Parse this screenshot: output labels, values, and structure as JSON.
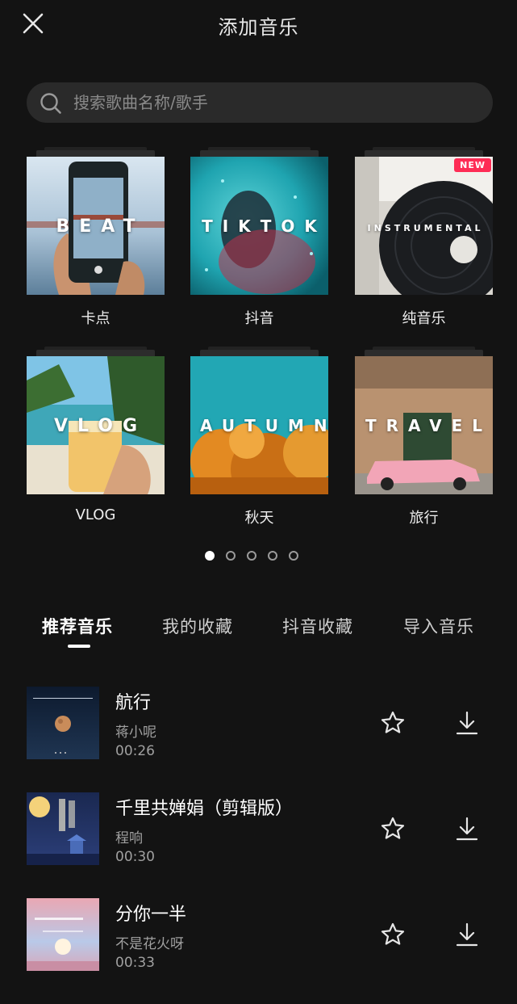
{
  "header": {
    "title": "添加音乐",
    "close_icon": "close-icon"
  },
  "search": {
    "placeholder": "搜索歌曲名称/歌手",
    "value": "",
    "icon": "search-icon"
  },
  "categories": [
    {
      "label": "卡点",
      "art_text": "BEAT"
    },
    {
      "label": "抖音",
      "art_text": "TIKTOK"
    },
    {
      "label": "纯音乐",
      "art_text": "INSTRUMENTAL",
      "badge": "NEW"
    },
    {
      "label": "VLOG",
      "art_text": "VLOG"
    },
    {
      "label": "秋天",
      "art_text": "AUTUMN"
    },
    {
      "label": "旅行",
      "art_text": "TRAVEL"
    }
  ],
  "pagination": {
    "total": 5,
    "current": 1
  },
  "tabs": [
    {
      "label": "推荐音乐",
      "active": true
    },
    {
      "label": "我的收藏",
      "active": false
    },
    {
      "label": "抖音收藏",
      "active": false
    },
    {
      "label": "导入音乐",
      "active": false
    }
  ],
  "songs": [
    {
      "title": "航行",
      "artist": "蒋小呢",
      "duration": "00:26"
    },
    {
      "title": "千里共婵娟（剪辑版）",
      "artist": "程响",
      "duration": "00:30"
    },
    {
      "title": "分你一半",
      "artist": "不是花火呀",
      "duration": "00:33"
    }
  ],
  "colors": {
    "background": "#131313",
    "search_bg": "#2a2a2a",
    "badge": "#fe2c55",
    "secondary_text": "#a0a0a0"
  }
}
